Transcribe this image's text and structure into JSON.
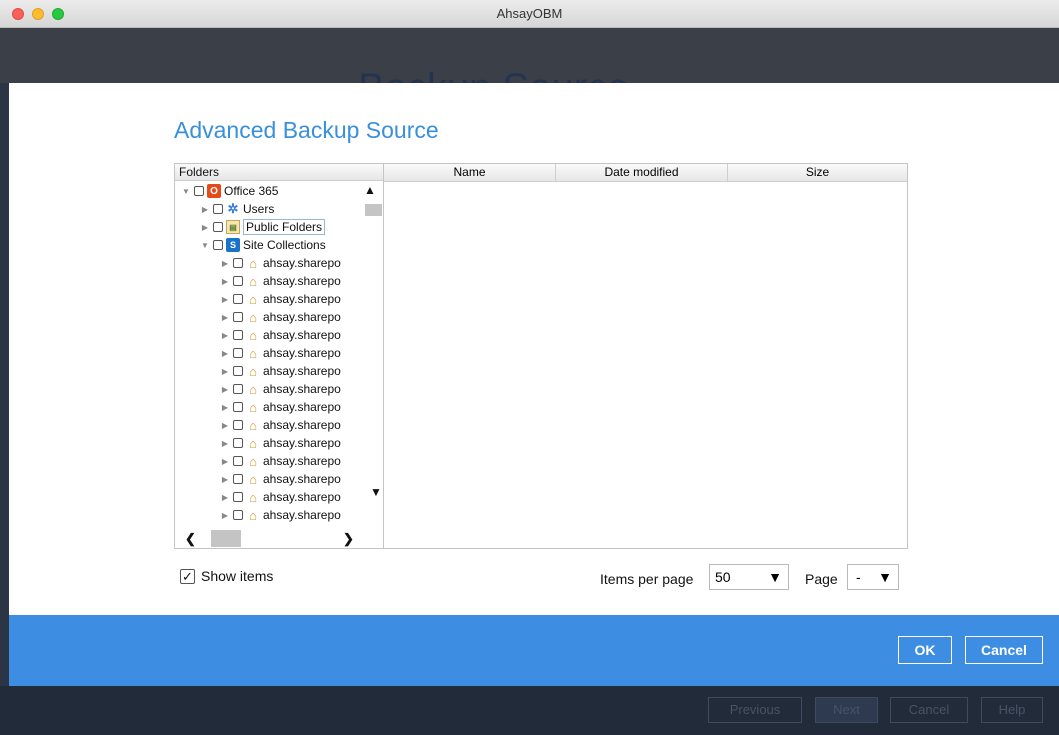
{
  "window": {
    "title": "AhsayOBM"
  },
  "background": {
    "ghost_title": "Backup Source"
  },
  "dialog": {
    "title": "Advanced Backup Source",
    "tree": {
      "header": "Folders",
      "root": {
        "label": "Office 365"
      },
      "items": [
        {
          "label": "Users",
          "icon": "users-icon"
        },
        {
          "label": "Public Folders",
          "icon": "public-folders-icon"
        },
        {
          "label": "Site Collections",
          "icon": "sharepoint-icon"
        }
      ],
      "sites": [
        "ahsay.sharepo",
        "ahsay.sharepo",
        "ahsay.sharepo",
        "ahsay.sharepo",
        "ahsay.sharepo",
        "ahsay.sharepo",
        "ahsay.sharepo",
        "ahsay.sharepo",
        "ahsay.sharepo",
        "ahsay.sharepo",
        "ahsay.sharepo",
        "ahsay.sharepo",
        "ahsay.sharepo",
        "ahsay.sharepo",
        "ahsay.sharepo",
        "ahsay.sharepo"
      ]
    },
    "list": {
      "columns": [
        "Name",
        "Date modified",
        "Size"
      ]
    },
    "show_items": {
      "label": "Show items",
      "checked": true
    },
    "items_per_page": {
      "label": "Items per page",
      "value": "50"
    },
    "page": {
      "label": "Page",
      "value": "-"
    },
    "buttons": {
      "ok": "OK",
      "cancel": "Cancel"
    }
  },
  "footer": {
    "buttons": [
      "Previous",
      "Next",
      "Cancel",
      "Help"
    ]
  },
  "colors": {
    "accent": "#3d8ee3",
    "title": "#3a8fdc",
    "office_icon": "#e64a19",
    "sharepoint_icon": "#1a73c8"
  }
}
